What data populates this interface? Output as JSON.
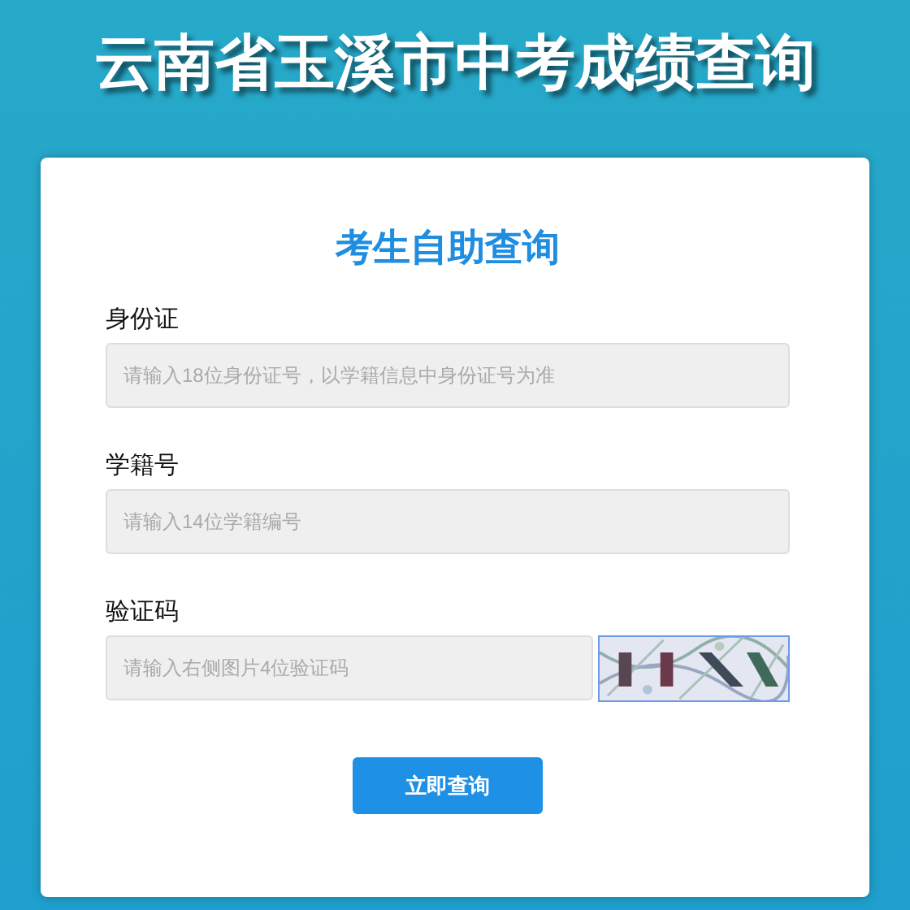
{
  "page_title": "云南省玉溪市中考成绩查询",
  "form": {
    "heading": "考生自助查询",
    "fields": [
      {
        "kind": "text",
        "label": "身份证",
        "placeholder": "请输入18位身份证号，以学籍信息中身份证号为准"
      },
      {
        "kind": "text",
        "label": "学籍号",
        "placeholder": "请输入14位学籍编号"
      },
      {
        "kind": "captcha",
        "label": "验证码",
        "placeholder": "请输入右侧图片4位验证码"
      }
    ],
    "submit": "立即查询"
  }
}
